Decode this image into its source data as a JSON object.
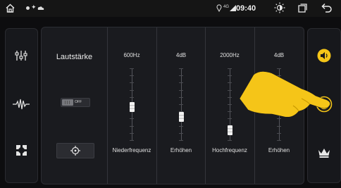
{
  "status": {
    "time": "09:40",
    "network": "4G"
  },
  "volume": {
    "label": "Lautstärke",
    "toggle_state": "OFF"
  },
  "bands": [
    {
      "top": "600Hz",
      "bottom": "Niederfrequenz",
      "level": 0.45
    },
    {
      "top": "4dB",
      "bottom": "Erhöhen",
      "level": 0.3
    },
    {
      "top": "2000Hz",
      "bottom": "Hochfrequenz",
      "level": 0.08
    },
    {
      "top": "4dB",
      "bottom": "Erhöhen",
      "level": 0.6
    }
  ],
  "colors": {
    "accent": "#f5c518",
    "background": "#0d0d0f",
    "panel": "#1a1b1f"
  },
  "icons": {
    "home": "home-icon",
    "back": "back-icon",
    "brightness": "brightness-icon",
    "window": "window-icon",
    "eq": "equalizer-sliders-icon",
    "waveform": "waveform-icon",
    "surround": "surround-icon",
    "speaker": "speaker-icon",
    "loudness": "loudness-icon",
    "crown": "crown-icon",
    "target": "crosshair-icon",
    "hand": "pointing-hand-icon"
  }
}
